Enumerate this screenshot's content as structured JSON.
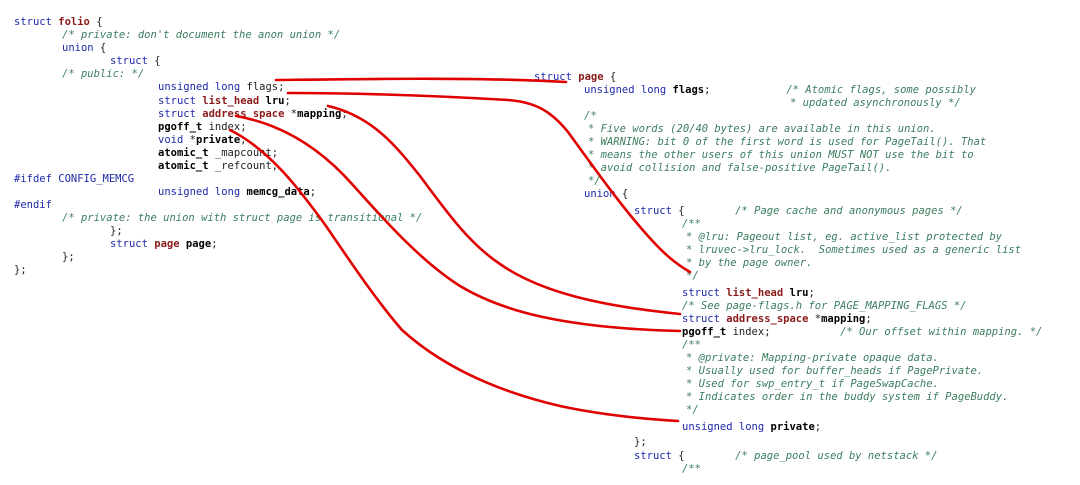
{
  "left_panel": {
    "lines": [
      [
        {
          "t": "struct ",
          "c": "kw"
        },
        {
          "t": "folio",
          "c": "name"
        },
        {
          "t": " {",
          "c": "plain"
        }
      ],
      [
        {
          "t": "/* private: don't document the anon union */",
          "c": "cmt"
        }
      ],
      [
        {
          "t": "union",
          "c": "kw"
        },
        {
          "t": " {",
          "c": "plain"
        }
      ],
      [
        {
          "t": "struct",
          "c": "kw"
        },
        {
          "t": " {",
          "c": "plain"
        }
      ],
      [
        {
          "t": "/* public: */",
          "c": "cmt"
        }
      ],
      [
        {
          "t": "unsigned long ",
          "c": "type"
        },
        {
          "t": "flags",
          "c": "plain"
        },
        {
          "t": ";",
          "c": "plain"
        }
      ],
      [
        {
          "t": "struct ",
          "c": "kw"
        },
        {
          "t": "list_head",
          "c": "name"
        },
        {
          "t": " ",
          "c": "plain"
        },
        {
          "t": "lru",
          "c": "field"
        },
        {
          "t": ";",
          "c": "plain"
        }
      ],
      [
        {
          "t": "struct ",
          "c": "kw"
        },
        {
          "t": "address_space",
          "c": "name"
        },
        {
          "t": " *",
          "c": "plain"
        },
        {
          "t": "mapping",
          "c": "field"
        },
        {
          "t": ";",
          "c": "plain"
        }
      ],
      [
        {
          "t": "pgoff_t",
          "c": "bold"
        },
        {
          "t": " index;",
          "c": "plain"
        }
      ],
      [
        {
          "t": "void ",
          "c": "type"
        },
        {
          "t": "*",
          "c": "plain"
        },
        {
          "t": "private",
          "c": "field"
        },
        {
          "t": ";",
          "c": "plain"
        }
      ],
      [
        {
          "t": "atomic_t",
          "c": "bold"
        },
        {
          "t": " _mapcount;",
          "c": "plain"
        }
      ],
      [
        {
          "t": "atomic_t",
          "c": "bold"
        },
        {
          "t": " _refcount;",
          "c": "plain"
        }
      ],
      [
        {
          "t": "#ifdef ",
          "c": "pp"
        },
        {
          "t": "CONFIG_MEMCG",
          "c": "pp"
        }
      ],
      [
        {
          "t": "unsigned long ",
          "c": "type"
        },
        {
          "t": "memcg_data",
          "c": "field"
        },
        {
          "t": ";",
          "c": "plain"
        }
      ],
      [
        {
          "t": "#endif",
          "c": "pp"
        }
      ],
      [
        {
          "t": "/* private: the union with struct page is transitional */",
          "c": "cmt"
        }
      ],
      [
        {
          "t": "};",
          "c": "plain"
        }
      ],
      [
        {
          "t": "struct ",
          "c": "kw"
        },
        {
          "t": "page",
          "c": "name"
        },
        {
          "t": " ",
          "c": "plain"
        },
        {
          "t": "page",
          "c": "field"
        },
        {
          "t": ";",
          "c": "plain"
        }
      ],
      [
        {
          "t": "};",
          "c": "plain"
        }
      ],
      [
        {
          "t": "};",
          "c": "plain"
        }
      ]
    ]
  },
  "right_panel": {
    "lines": [
      [
        {
          "t": "struct ",
          "c": "kw"
        },
        {
          "t": "page",
          "c": "name"
        },
        {
          "t": " {",
          "c": "plain"
        }
      ],
      [
        {
          "t": "unsigned long ",
          "c": "type"
        },
        {
          "t": "flags",
          "c": "field"
        },
        {
          "t": ";            ",
          "c": "plain"
        },
        {
          "t": "/* Atomic flags, some possibly",
          "c": "cmt"
        }
      ],
      [
        {
          "t": "* updated asynchronously */",
          "c": "cmt"
        }
      ],
      [
        {
          "t": "/*",
          "c": "cmt"
        }
      ],
      [
        {
          "t": "* Five words (20/40 bytes) are available in this union.",
          "c": "cmt"
        }
      ],
      [
        {
          "t": "* WARNING: bit 0 of the first word is used for PageTail(). That",
          "c": "cmt"
        }
      ],
      [
        {
          "t": "* means the other users of this union MUST NOT use the bit to",
          "c": "cmt"
        }
      ],
      [
        {
          "t": "* avoid collision and false-positive PageTail().",
          "c": "cmt"
        }
      ],
      [
        {
          "t": "*/",
          "c": "cmt"
        }
      ],
      [
        {
          "t": "union",
          "c": "kw"
        },
        {
          "t": " {",
          "c": "plain"
        }
      ],
      [
        {
          "t": "struct",
          "c": "kw"
        },
        {
          "t": " {        ",
          "c": "plain"
        },
        {
          "t": "/* Page cache and anonymous pages */",
          "c": "cmt"
        }
      ],
      [
        {
          "t": "/**",
          "c": "cmt"
        }
      ],
      [
        {
          "t": "* @lru: Pageout list, eg. active_list protected by",
          "c": "cmt"
        }
      ],
      [
        {
          "t": "* lruvec->lru_lock.  Sometimes used as a generic list",
          "c": "cmt"
        }
      ],
      [
        {
          "t": "* by the page owner.",
          "c": "cmt"
        }
      ],
      [
        {
          "t": "*/",
          "c": "cmt"
        }
      ],
      [
        {
          "t": "struct ",
          "c": "kw"
        },
        {
          "t": "list_head",
          "c": "name"
        },
        {
          "t": " ",
          "c": "plain"
        },
        {
          "t": "lru",
          "c": "field"
        },
        {
          "t": ";",
          "c": "plain"
        }
      ],
      [
        {
          "t": "/* See page-flags.h for PAGE_MAPPING_FLAGS */",
          "c": "cmt"
        }
      ],
      [
        {
          "t": "struct ",
          "c": "kw"
        },
        {
          "t": "address_space",
          "c": "name"
        },
        {
          "t": " *",
          "c": "plain"
        },
        {
          "t": "mapping",
          "c": "field"
        },
        {
          "t": ";",
          "c": "plain"
        }
      ],
      [
        {
          "t": "pgoff_t",
          "c": "bold"
        },
        {
          "t": " index;           ",
          "c": "plain"
        },
        {
          "t": "/* Our offset within mapping. */",
          "c": "cmt"
        }
      ],
      [
        {
          "t": "/**",
          "c": "cmt"
        }
      ],
      [
        {
          "t": "* @private: Mapping-private opaque data.",
          "c": "cmt"
        }
      ],
      [
        {
          "t": "* Usually used for buffer_heads if PagePrivate.",
          "c": "cmt"
        }
      ],
      [
        {
          "t": "* Used for swp_entry_t if PageSwapCache.",
          "c": "cmt"
        }
      ],
      [
        {
          "t": "* Indicates order in the buddy system if PageBuddy.",
          "c": "cmt"
        }
      ],
      [
        {
          "t": "*/",
          "c": "cmt"
        }
      ],
      [
        {
          "t": "unsigned long ",
          "c": "type"
        },
        {
          "t": "private",
          "c": "field"
        },
        {
          "t": ";",
          "c": "plain"
        }
      ],
      [
        {
          "t": "};",
          "c": "plain"
        }
      ],
      [
        {
          "t": "struct",
          "c": "kw"
        },
        {
          "t": " {        ",
          "c": "plain"
        },
        {
          "t": "/* page_pool used by netstack */",
          "c": "cmt"
        }
      ],
      [
        {
          "t": "/**",
          "c": "cmt"
        }
      ]
    ]
  },
  "connector_color": "#e00000",
  "connectors": [
    {
      "from": "folio.flags",
      "to": "page.flags"
    },
    {
      "from": "folio.lru",
      "to": "page.lru"
    },
    {
      "from": "folio.mapping",
      "to": "page.mapping"
    },
    {
      "from": "folio.index",
      "to": "page.index"
    },
    {
      "from": "folio.private",
      "to": "page.private"
    }
  ]
}
